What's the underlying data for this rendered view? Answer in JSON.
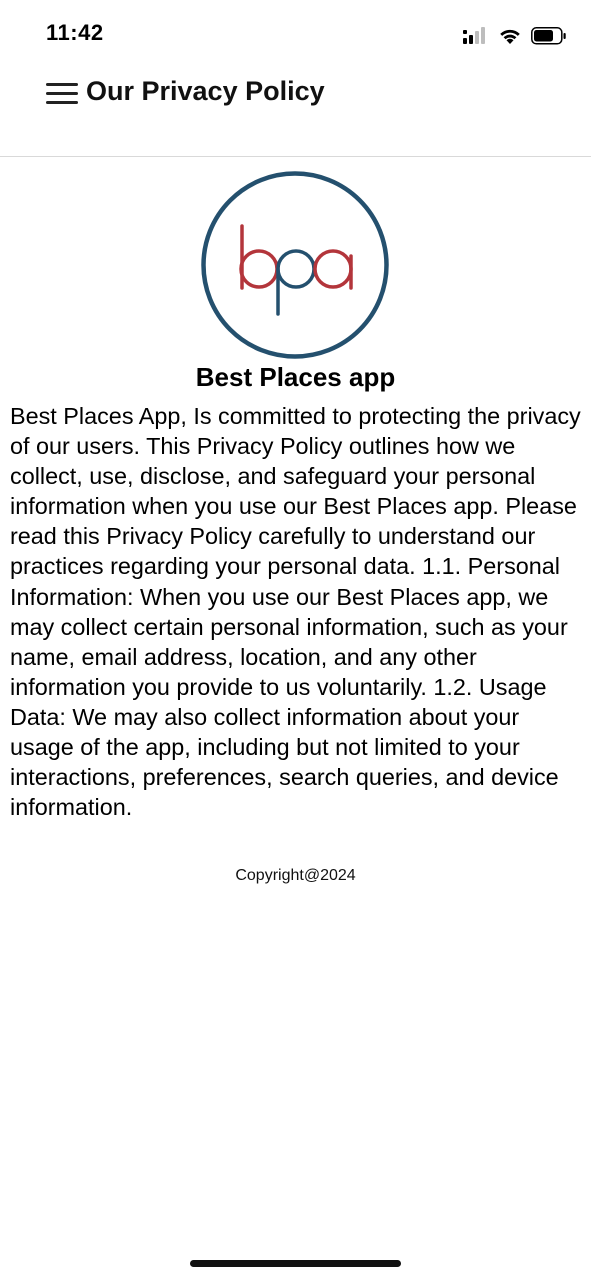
{
  "status_bar": {
    "time": "11:42"
  },
  "header": {
    "title": "Our Privacy Policy"
  },
  "logo": {
    "text": "bpa",
    "ring_color": "#24506e",
    "letter_b_color": "#b3353b",
    "letter_p_color": "#24506e",
    "letter_a_color": "#b3353b"
  },
  "content": {
    "app_name": "Best Places app",
    "policy_text": "Best Places App, Is committed to protecting the privacy of our users. This Privacy Policy outlines how we collect, use, disclose, and safeguard your personal information when you use our Best Places app. Please read this Privacy Policy carefully to understand our practices regarding your personal data. 1.1. Personal Information: When you use our Best Places app, we may collect certain personal information, such as your name, email address, location, and any other information you provide to us voluntarily. 1.2. Usage Data: We may also collect information about your usage of the app, including but not limited to your interactions, preferences, search queries, and device information.",
    "copyright": "Copyright@2024"
  }
}
